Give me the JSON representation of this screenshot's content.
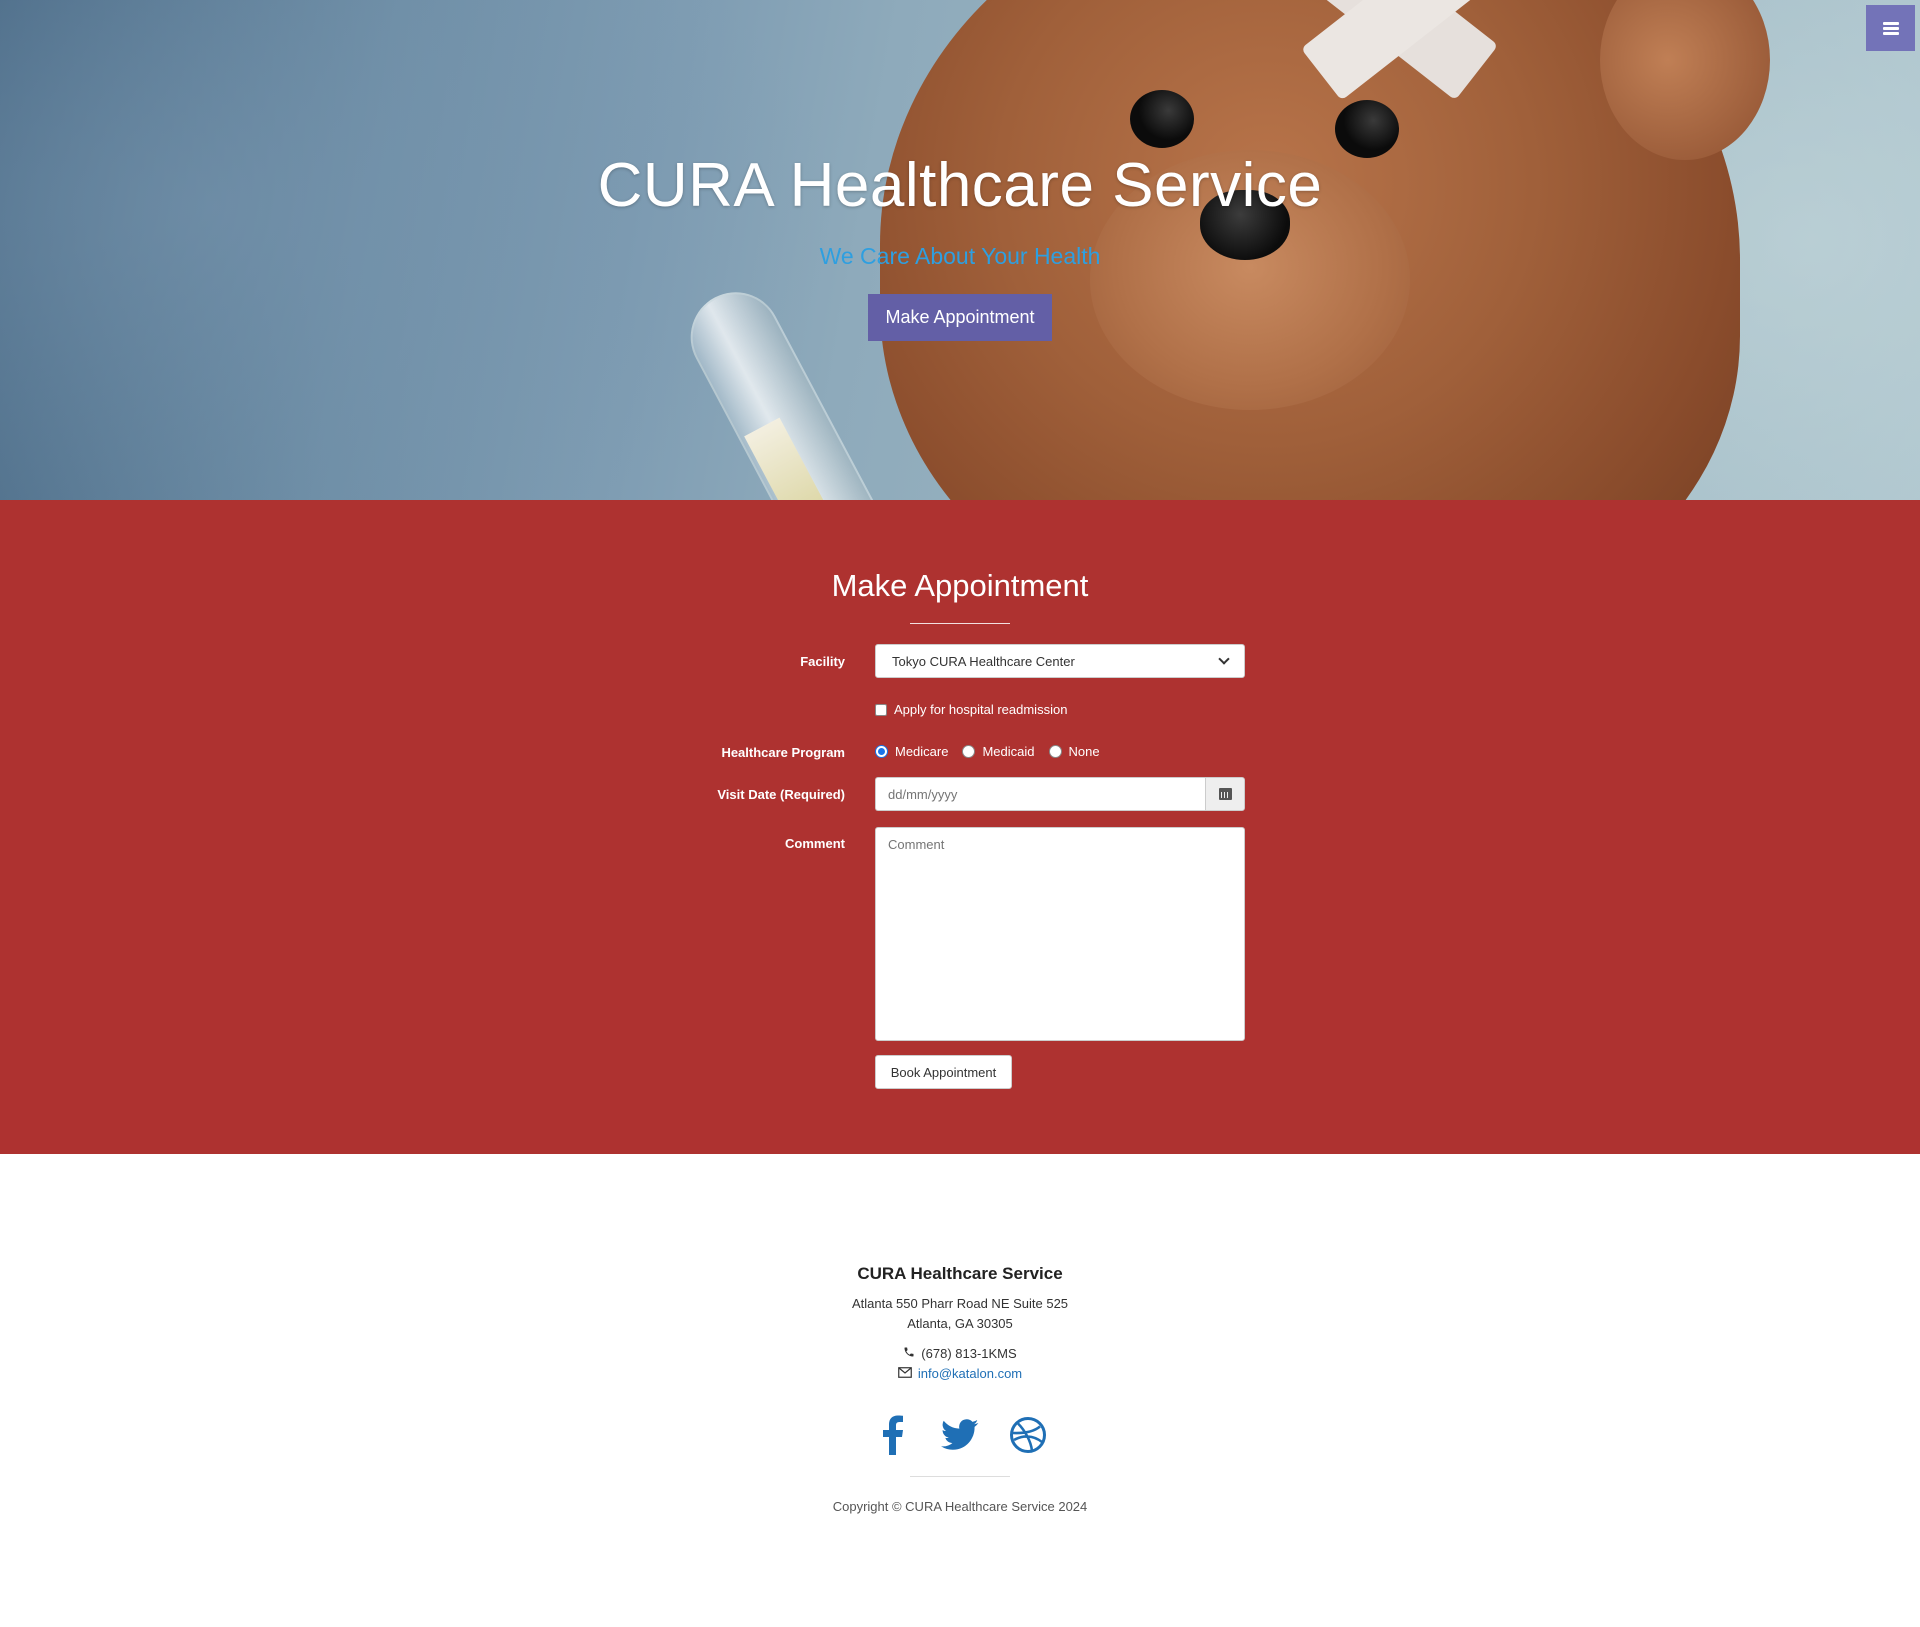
{
  "hero": {
    "title": "CURA Healthcare Service",
    "subtitle": "We Care About Your Health",
    "cta_label": "Make Appointment",
    "menu_icon": "hamburger-icon"
  },
  "appointment": {
    "title": "Make Appointment",
    "facility_label": "Facility",
    "facility_selected": "Tokyo CURA Healthcare Center",
    "readmission_label": "Apply for hospital readmission",
    "program_label": "Healthcare Program",
    "programs": [
      "Medicare",
      "Medicaid",
      "None"
    ],
    "program_selected": "Medicare",
    "visit_date_label": "Visit Date (Required)",
    "visit_date_placeholder": "dd/mm/yyyy",
    "comment_label": "Comment",
    "comment_placeholder": "Comment",
    "book_label": "Book Appointment"
  },
  "footer": {
    "name": "CURA Healthcare Service",
    "address_line1": "Atlanta 550 Pharr Road NE Suite 525",
    "address_line2": "Atlanta, GA 30305",
    "phone": "(678) 813-1KMS",
    "email": "info@katalon.com",
    "socials": [
      "facebook-icon",
      "twitter-icon",
      "dribbble-icon"
    ],
    "copyright": "Copyright © CURA Healthcare Service 2024"
  },
  "colors": {
    "accent": "#635fa6",
    "section_bg": "#ae3230",
    "subtitle": "#2e9fe0",
    "link": "#1f6fb5"
  }
}
